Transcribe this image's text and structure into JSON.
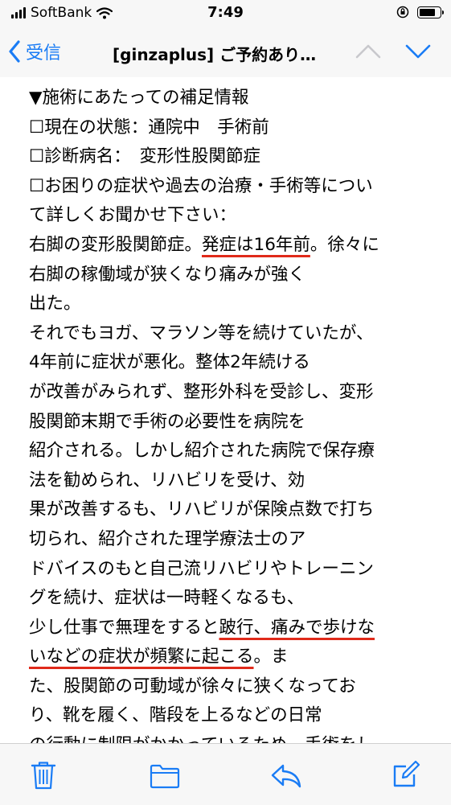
{
  "status_bar": {
    "carrier": "SoftBank",
    "time": "7:49",
    "battery_level": 0.85
  },
  "nav": {
    "back_label": "受信",
    "title": "[ginzaplus] ご予約あり…"
  },
  "body": {
    "lines": [
      {
        "segments": [
          {
            "text": "▼施術にあたっての補足情報"
          }
        ]
      },
      {
        "segments": [
          {
            "text": "☐現在の状態：通院中　手術前"
          }
        ]
      },
      {
        "segments": [
          {
            "text": "☐診断病名：　変形性股関節症"
          }
        ]
      },
      {
        "segments": [
          {
            "text": "☐お困りの症状や過去の治療・手術等につい"
          }
        ]
      },
      {
        "segments": [
          {
            "text": "て詳しくお聞かせ下さい："
          }
        ]
      },
      {
        "segments": [
          {
            "text": "右脚の変形股関節症。"
          },
          {
            "text": "発症は16年前",
            "underline": true
          },
          {
            "text": "。徐々に"
          }
        ]
      },
      {
        "segments": [
          {
            "text": "右脚の稼働域が狭くなり痛みが強く"
          }
        ]
      },
      {
        "segments": [
          {
            "text": "出た。"
          }
        ]
      },
      {
        "segments": [
          {
            "text": "それでもヨガ、マラソン等を続けていたが、"
          }
        ]
      },
      {
        "segments": [
          {
            "text": "4年前に症状が悪化。整体2年続ける"
          }
        ]
      },
      {
        "segments": [
          {
            "text": "が改善がみられず、整形外科を受診し、変形"
          }
        ]
      },
      {
        "segments": [
          {
            "text": "股関節末期で手術の必要性を病院を"
          }
        ]
      },
      {
        "segments": [
          {
            "text": "紹介される。しかし紹介された病院で保存療"
          }
        ]
      },
      {
        "segments": [
          {
            "text": "法を勧められ、リハビリを受け、効"
          }
        ]
      },
      {
        "segments": [
          {
            "text": "果が改善するも、リハビリが保険点数で打ち"
          }
        ]
      },
      {
        "segments": [
          {
            "text": "切られ、紹介された理学療法士のア"
          }
        ]
      },
      {
        "segments": [
          {
            "text": "ドバイスのもと自己流リハビリやトレーニン"
          }
        ]
      },
      {
        "segments": [
          {
            "text": "グを続け、症状は一時軽くなるも、"
          }
        ]
      },
      {
        "segments": [
          {
            "text": "少し仕事で無理をすると"
          },
          {
            "text": "跛行、痛みで歩けな",
            "underline": true
          }
        ]
      },
      {
        "segments": [
          {
            "text": "いなどの症状が頻繁に起こる",
            "underline": true
          },
          {
            "text": "。ま"
          }
        ]
      },
      {
        "segments": [
          {
            "text": "た、股関節の可動域が徐々に狭くなってお"
          }
        ]
      },
      {
        "segments": [
          {
            "text": "り、靴を履く、階段を上るなどの日常"
          }
        ]
      },
      {
        "segments": [
          {
            "text": "の行動に制限がかかっているため、手術をし"
          }
        ]
      }
    ]
  },
  "toolbar": {
    "icons": [
      "trash-icon",
      "folder-icon",
      "reply-icon",
      "compose-icon"
    ]
  },
  "colors": {
    "accent": "#1a7cf5",
    "underline": "#e02a1a",
    "bar_background": "#f7f7f7"
  }
}
